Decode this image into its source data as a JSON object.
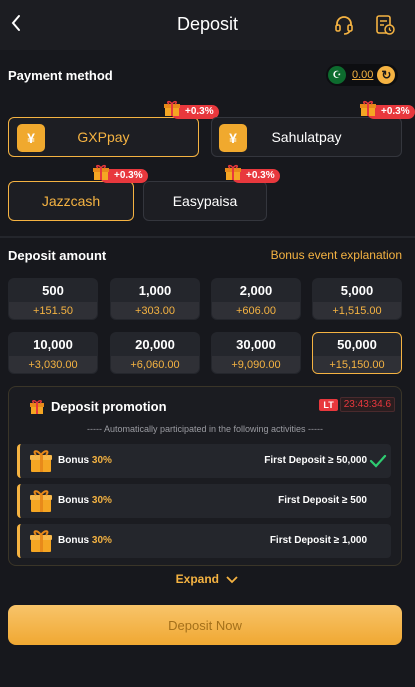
{
  "header": {
    "title": "Deposit",
    "back_icon": "chevron-left-icon",
    "support_icon": "headset-icon",
    "history_icon": "history-document-icon"
  },
  "payment_method": {
    "title": "Payment method",
    "balance": "0.00",
    "currency_flag": "pakistan-flag-icon",
    "methods": [
      {
        "label": "GXPpay",
        "badge": "+0.3%",
        "active": true,
        "has_icon": true
      },
      {
        "label": "Sahulatpay",
        "badge": "+0.3%",
        "active": false,
        "has_icon": true
      },
      {
        "label": "Jazzcash",
        "badge": "+0.3%",
        "active": true,
        "has_icon": false
      },
      {
        "label": "Easypaisa",
        "badge": "+0.3%",
        "active": false,
        "has_icon": false
      }
    ]
  },
  "deposit_amount": {
    "title": "Deposit amount",
    "bonus_link": "Bonus event explanation",
    "amounts": [
      {
        "amount": "500",
        "bonus": "+151.50",
        "selected": false
      },
      {
        "amount": "1,000",
        "bonus": "+303.00",
        "selected": false
      },
      {
        "amount": "2,000",
        "bonus": "+606.00",
        "selected": false
      },
      {
        "amount": "5,000",
        "bonus": "+1,515.00",
        "selected": false
      },
      {
        "amount": "10,000",
        "bonus": "+3,030.00",
        "selected": false
      },
      {
        "amount": "20,000",
        "bonus": "+6,060.00",
        "selected": false
      },
      {
        "amount": "30,000",
        "bonus": "+9,090.00",
        "selected": false
      },
      {
        "amount": "50,000",
        "bonus": "+15,150.00",
        "selected": true
      }
    ]
  },
  "promotion": {
    "title": "Deposit promotion",
    "lt_label": "LT",
    "timer": "23:43:34.6",
    "auto_text": "----- Automatically participated in the following activities -----",
    "rows": [
      {
        "bonus_label": "Bonus",
        "bonus_pct": "30%",
        "condition": "First Deposit ≥ 50,000",
        "checked": true
      },
      {
        "bonus_label": "Bonus",
        "bonus_pct": "30%",
        "condition": "First Deposit ≥ 500",
        "checked": false
      },
      {
        "bonus_label": "Bonus",
        "bonus_pct": "30%",
        "condition": "First Deposit ≥ 1,000",
        "checked": false
      }
    ]
  },
  "expand_label": "Expand",
  "deposit_button": "Deposit Now",
  "colors": {
    "accent": "#f5b342",
    "background": "#17181d",
    "card": "#24262c",
    "badge": "#e8383d"
  }
}
